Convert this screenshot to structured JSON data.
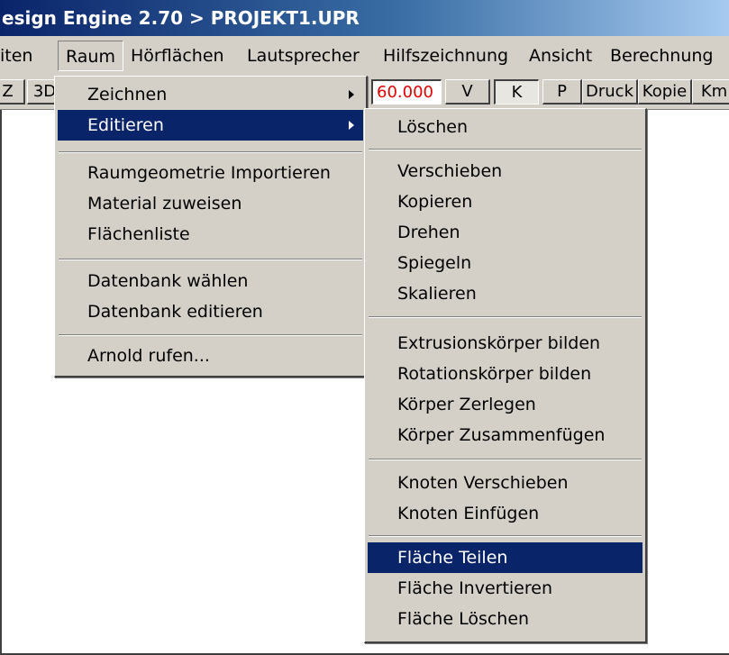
{
  "title": "esign Engine 2.70 > PROJEKT1.UPR",
  "menubar": [
    "iten",
    "Raum",
    "Hörflächen",
    "Lautsprecher",
    "Hilfszeichnung",
    "Ansicht",
    "Berechnung"
  ],
  "toolbar": {
    "btn_left1": "Z",
    "btn_3d": "3D",
    "value": "60.000",
    "btn_v": "V",
    "btn_k": "K",
    "btn_p": "P",
    "btn_druck": "Druck",
    "btn_kopie": "Kopie",
    "btn_km": "Km"
  },
  "raum_menu": {
    "zeichnen": "Zeichnen",
    "editieren": "Editieren",
    "raumgeometrie": "Raumgeometrie Importieren",
    "material": "Material zuweisen",
    "flaechenliste": "Flächenliste",
    "datenbank_waehlen": "Datenbank wählen",
    "datenbank_editieren": "Datenbank editieren",
    "arnold": "Arnold rufen..."
  },
  "editieren_menu": {
    "loeschen": "Löschen",
    "verschieben": "Verschieben",
    "kopieren": "Kopieren",
    "drehen": "Drehen",
    "spiegeln": "Spiegeln",
    "skalieren": "Skalieren",
    "extrusion": "Extrusionskörper bilden",
    "rotation": "Rotationskörper bilden",
    "zerlegen": "Körper Zerlegen",
    "zusammenfuegen": "Körper Zusammenfügen",
    "knoten_verschieben": "Knoten Verschieben",
    "knoten_einfuegen": "Knoten Einfügen",
    "flaeche_teilen": "Fläche Teilen",
    "flaeche_invertieren": "Fläche Invertieren",
    "flaeche_loeschen": "Fläche Löschen"
  },
  "colors": {
    "highlight": "#0a246a",
    "face": "#d4d0c8",
    "value_text": "#e00000"
  }
}
